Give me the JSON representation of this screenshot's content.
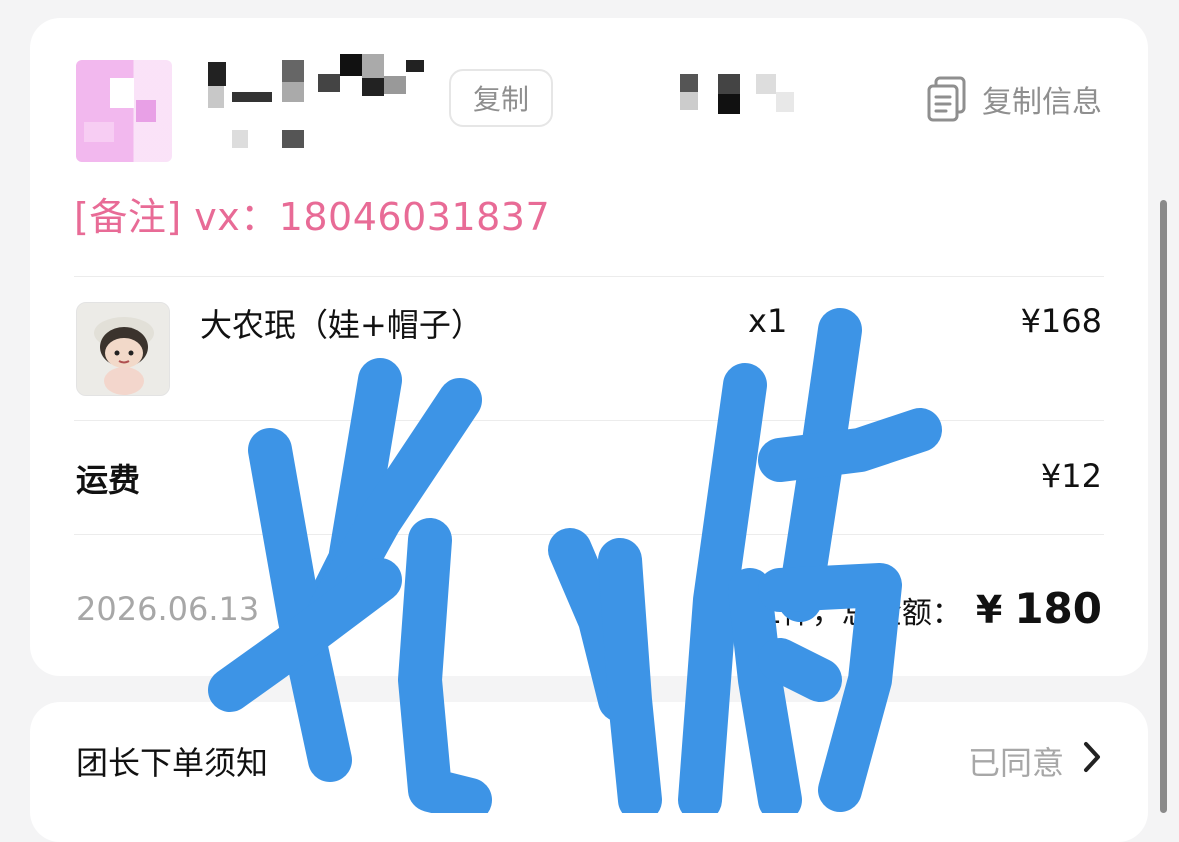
{
  "header": {
    "copy_button_label": "复制",
    "copy_info_label": "复制信息",
    "icons": {
      "copy_info": "copy-document-icon"
    }
  },
  "remark": "[备注] vx：18046031837",
  "order": {
    "item": {
      "title": "大农珉（娃+帽子）",
      "quantity": "x1",
      "price": "¥168"
    },
    "shipping": {
      "label": "运费",
      "price": "¥12"
    },
    "date": "2026.06.13",
    "summary": {
      "text": "共1件，总金额：",
      "currency": "¥",
      "total": "180"
    }
  },
  "notice": {
    "title": "团长下单须知",
    "status": "已同意",
    "icons": {
      "arrow": "chevron-right-icon"
    }
  },
  "colors": {
    "remark": "#e86b96",
    "scribble": "#3d94e6",
    "muted_text": "#a7a7a7",
    "background": "#f4f4f5"
  }
}
